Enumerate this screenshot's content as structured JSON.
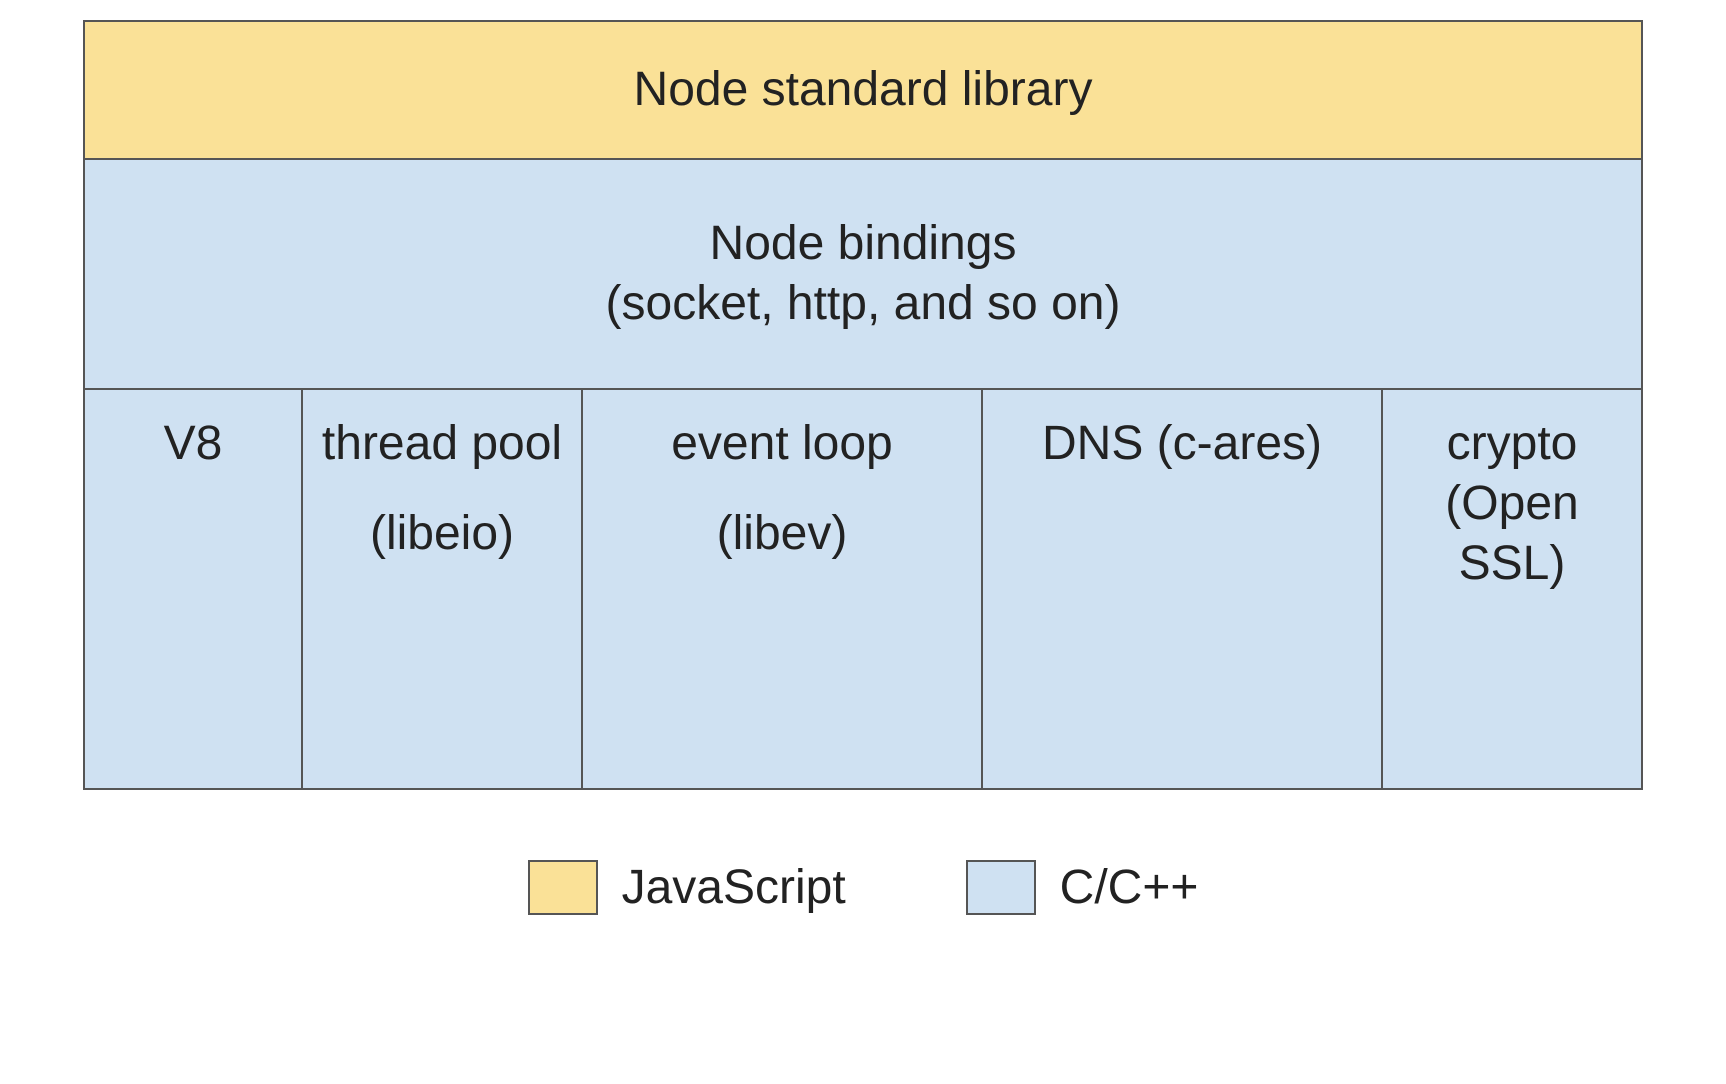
{
  "layers": {
    "top": {
      "label": "Node standard library"
    },
    "bindings": {
      "line1": "Node bindings",
      "line2": "(socket, http, and so on)"
    },
    "components": [
      {
        "title": "V8",
        "sub": ""
      },
      {
        "title": "thread pool",
        "sub": "(libeio)"
      },
      {
        "title": "event loop",
        "sub": "(libev)"
      },
      {
        "title": "DNS (c-ares)",
        "sub": ""
      },
      {
        "title": "crypto (Open SSL)",
        "sub": ""
      }
    ]
  },
  "legend": {
    "js": "JavaScript",
    "c": "C/C++"
  },
  "colors": {
    "javascript": "#fae197",
    "c_cpp": "#cfe1f2"
  }
}
